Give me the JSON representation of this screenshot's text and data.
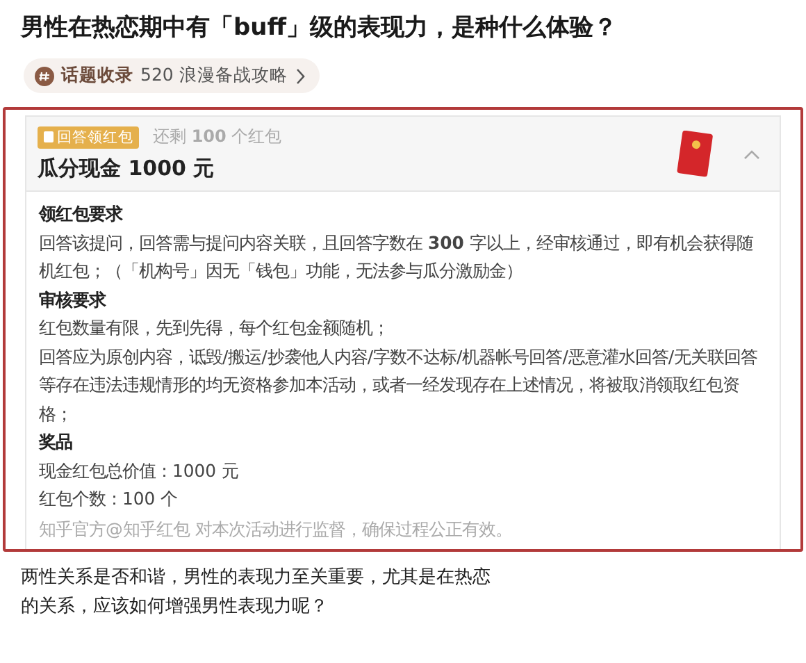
{
  "title": "男性在热恋期中有「buff」级的表现力，是种什么体验？",
  "topic": {
    "label": "话题收录",
    "text": "520 浪漫备战攻略"
  },
  "card": {
    "badge": "回答领红包",
    "remaining": "还剩 **100** 个红包",
    "heading": "瓜分现金 1000 元",
    "expanded": true,
    "sections": [
      {
        "heading": "领红包要求",
        "paragraphs": [
          "回答该提问，回答需与提问内容关联，且回答字数在 **300** 字以上，经审核通过，即有机会获得随机红包；（「机构号」因无「钱包」功能，无法参与瓜分激励金）"
        ]
      },
      {
        "heading": "审核要求",
        "paragraphs": [
          "红包数量有限，先到先得，每个红包金额随机；",
          "回答应为原创内容，诋毁/搬运/抄袭他人内容/字数不达标/机器帐号回答/恶意灌水回答/无关联回答等存在违法违规情形的均无资格参加本活动，或者一经发现存在上述情况，将被取消领取红包资格；"
        ]
      },
      {
        "heading": "奖品",
        "paragraphs": [
          "现金红包总价值：1000 元",
          "红包个数：100 个"
        ]
      }
    ],
    "footer": "知乎官方@知乎红包 对本次活动进行监督，确保过程公正有效。"
  },
  "article": {
    "lines": [
      "两性关系是否和谐，男性的表现力至关重要，尤其是在热恋",
      "的关系，应该如何增强男性表现力呢？"
    ]
  }
}
